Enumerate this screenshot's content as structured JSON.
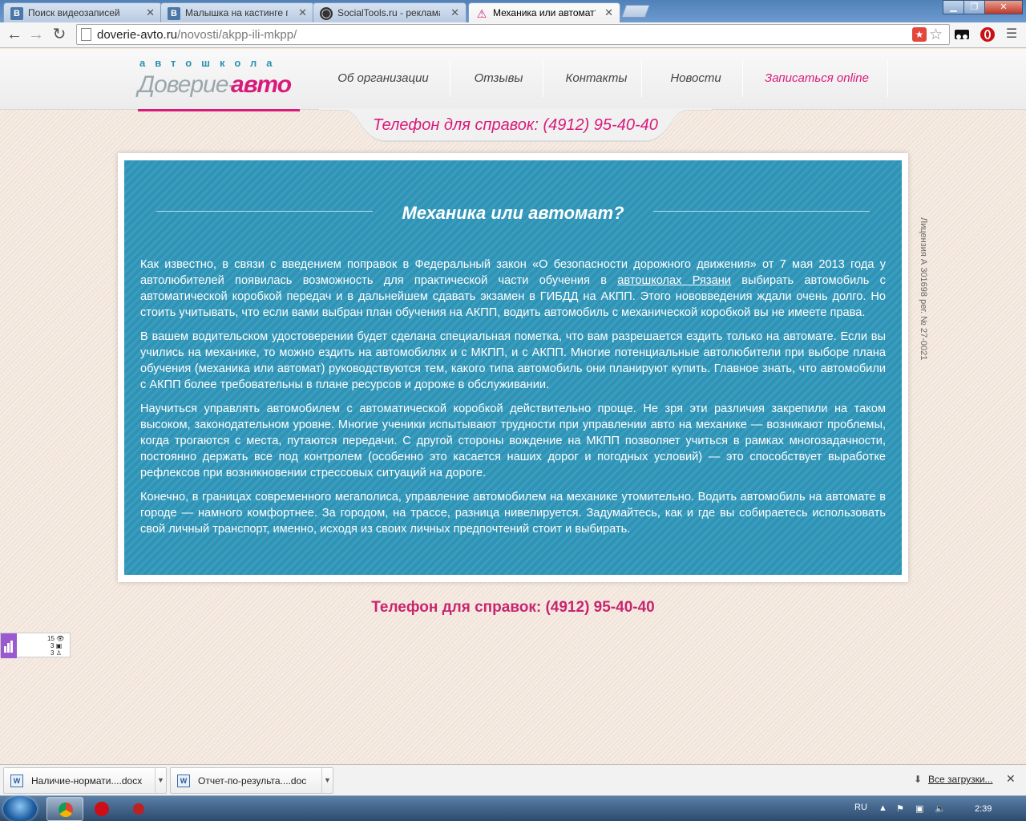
{
  "browser": {
    "tabs": [
      {
        "label": "Поиск видеозаписей",
        "favicon": "vk-icon",
        "color": "#4a76a8"
      },
      {
        "label": "Малышка на кастинге пр",
        "favicon": "vk-icon",
        "color": "#4a76a8"
      },
      {
        "label": "SocialTools.ru - реклама",
        "favicon": "socialtools-icon",
        "color": "#333333"
      },
      {
        "label": "Механика или автомат?",
        "favicon": "warning-icon",
        "color": "#d81b7a"
      }
    ],
    "url_host": "doverie-avto.ru",
    "url_path": "/novosti/akpp-ili-mkpp/"
  },
  "site": {
    "logo_tag": "автошкола",
    "logo_name1": "Доверие-",
    "logo_name2": "авто",
    "nav": [
      {
        "label": "Об организации",
        "accent": false
      },
      {
        "label": "Отзывы",
        "accent": false
      },
      {
        "label": "Контакты",
        "accent": false
      },
      {
        "label": "Новости",
        "accent": false
      },
      {
        "label": "Записаться online",
        "accent": true
      }
    ],
    "header_phone": "Телефон для справок: (4912) 95-40-40",
    "footer_phone": "Телефон для справок: (4912) 95-40-40",
    "license": "Лицензия А 301698 рег. № 27-0021",
    "accent_color": "#d81b7a",
    "card_color": "#2e94b7"
  },
  "article": {
    "title": "Механика или автомат?",
    "p1_before": "Как известно, в связи с введением поправок в Федеральный закон «О безопасности дорожного движения» от 7 мая 2013 года у автолюбителей появилась возможность для практической части обучения в ",
    "p1_link": "автошколах Рязани",
    "p1_after": " выбирать автомобиль с автоматической коробкой передач и в дальнейшем сдавать экзамен в ГИБДД на АКПП. Этого нововведения ждали очень долго. Но стоить учитывать, что если вами выбран план обучения на АКПП, водить автомобиль с механической коробкой вы не имеете права.",
    "p2": "В вашем водительском удостоверении будет сделана специальная пометка, что вам разрешается ездить только на автомате. Если вы учились на механике, то можно ездить на автомобилях и с МКПП, и с АКПП. Многие потенциальные автолюбители при выборе плана обучения (механика или автомат) руководствуются тем, какого типа автомобиль они планируют купить. Главное знать, что автомобили с АКПП более требовательны в плане ресурсов и дороже в обслуживании.",
    "p3": "Научиться управлять автомобилем с автоматической коробкой действительно проще. Не зря эти различия закрепили на таком высоком, законодательном уровне. Многие ученики испытывают трудности при управлении авто на механике — возникают проблемы, когда трогаются с места, путаются передачи. С другой стороны вождение на МКПП позволяет учиться в рамках многозадачности, постоянно держать все под контролем (особенно это касается наших дорог и погодных условий) — это способствует выработке рефлексов при возникновении стрессовых ситуаций на дороге.",
    "p4": "Конечно, в границах современного мегаполиса, управление автомобилем на механике утомительно. Водить автомобиль на автомате в городе — намного комфортнее. За городом, на трассе, разница нивелируется. Задумайтесь, как и где вы собираетесь использовать свой личный транспорт, именно, исходя из своих личных предпочтений стоит и выбирать."
  },
  "counter": {
    "views": "15",
    "visits": "3",
    "visitors": "3"
  },
  "downloads": {
    "items": [
      "Наличие-нормати....docx",
      "Отчет-по-результа....doc"
    ],
    "all_label": "Все загрузки..."
  },
  "taskbar": {
    "lang": "RU",
    "time": "2:39"
  }
}
